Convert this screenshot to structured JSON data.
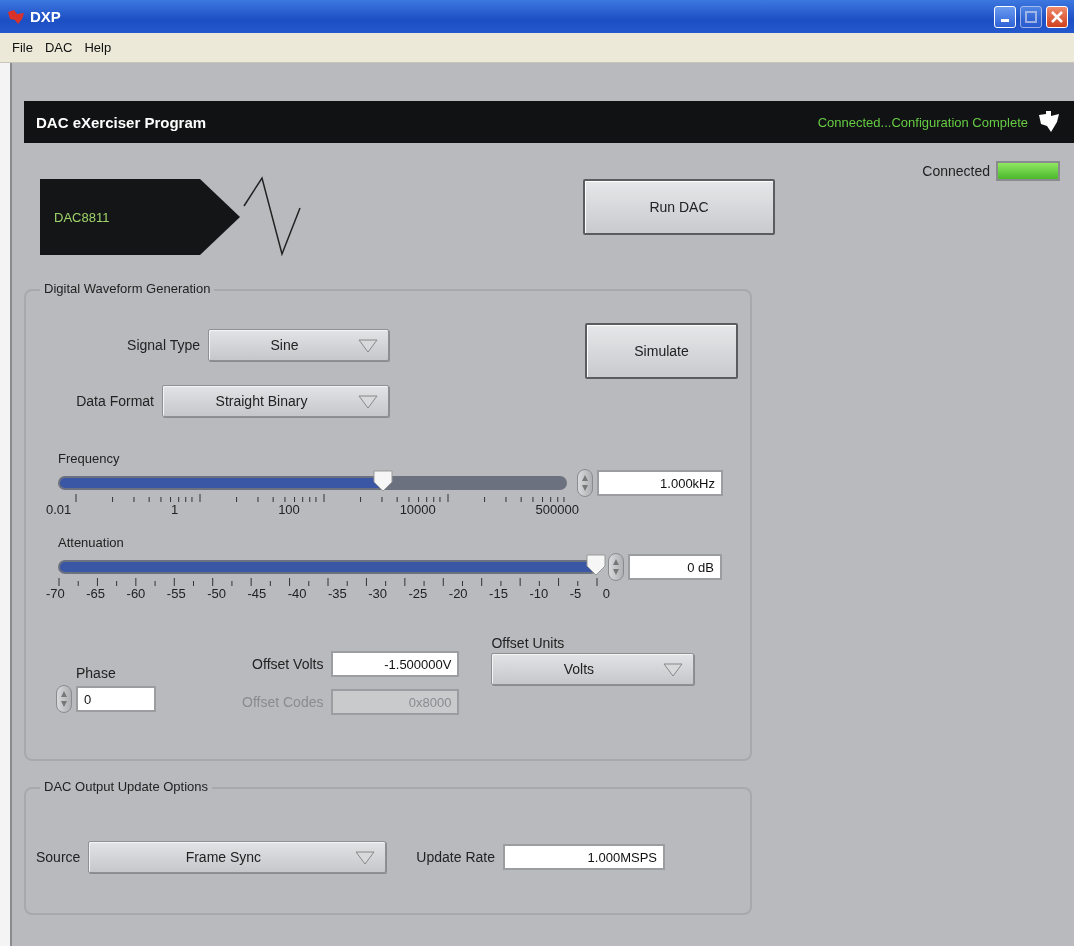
{
  "window": {
    "title": "DXP"
  },
  "menu": [
    {
      "label": "File"
    },
    {
      "label": "DAC"
    },
    {
      "label": "Help"
    }
  ],
  "header": {
    "title": "DAC eXerciser Program",
    "status": "Connected...Configuration Complete"
  },
  "device": {
    "name": "DAC8811"
  },
  "run_button": "Run DAC",
  "connected_indicator": {
    "label": "Connected",
    "on": true
  },
  "waveform_group": {
    "title": "Digital Waveform Generation",
    "signal_type": {
      "label": "Signal Type",
      "value": "Sine"
    },
    "data_format": {
      "label": "Data Format",
      "value": "Straight Binary"
    },
    "simulate_button": "Simulate",
    "frequency": {
      "label": "Frequency",
      "level": 0.64,
      "scale": [
        "0.01",
        "1",
        "100",
        "10000",
        "500000"
      ],
      "value": "1.000kHz"
    },
    "attenuation": {
      "label": "Attenuation",
      "level": 1,
      "scale": [
        "-70",
        "-65",
        "-60",
        "-55",
        "-50",
        "-45",
        "-40",
        "-35",
        "-30",
        "-25",
        "-20",
        "-15",
        "-10",
        "-5",
        "0"
      ],
      "value": "0 dB"
    },
    "phase": {
      "label": "Phase",
      "value": "0"
    },
    "offset_volts": {
      "label": "Offset Volts",
      "value": "-1.500000V",
      "disabled": false
    },
    "offset_codes": {
      "label": "Offset Codes",
      "value": "0x8000",
      "disabled": true
    },
    "offset_units": {
      "label": "Offset Units",
      "value": "Volts"
    }
  },
  "output_group": {
    "title": "DAC Output Update Options",
    "source": {
      "label": "Source",
      "value": "Frame Sync"
    },
    "update_rate": {
      "label": "Update Rate",
      "value": "1.000MSPS"
    }
  }
}
